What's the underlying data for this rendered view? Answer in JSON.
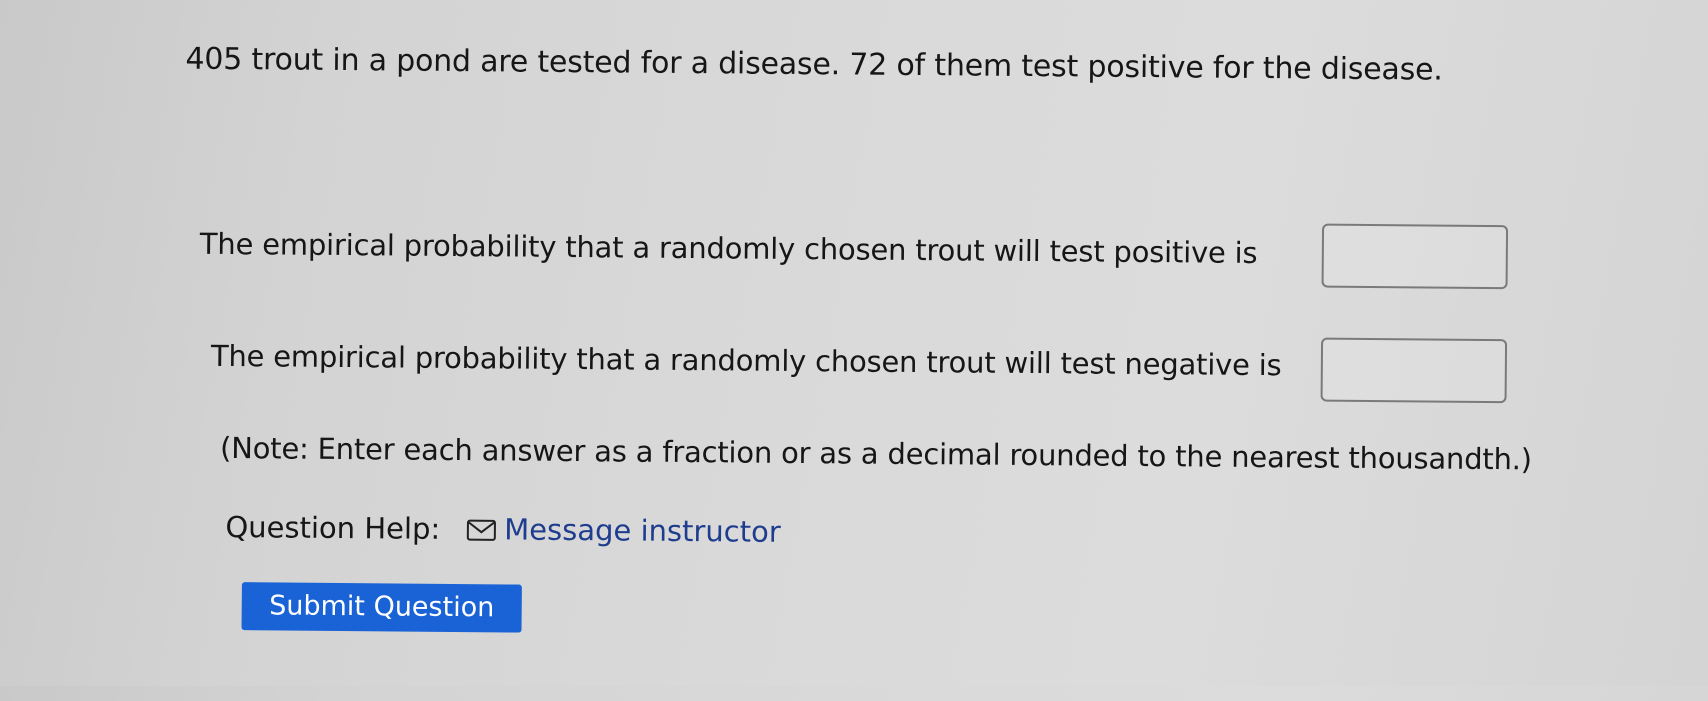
{
  "problem": {
    "text": "405 trout in a pond are tested for a disease. 72 of them test positive for the disease."
  },
  "questions": [
    {
      "text": "The empirical probability that a randomly chosen trout will test positive is",
      "answer_value": "",
      "answer_placeholder": ""
    },
    {
      "text": "The empirical probability that a randomly chosen trout will test negative is",
      "answer_value": "",
      "answer_placeholder": ""
    }
  ],
  "note": "(Note: Enter each answer as a fraction or as a decimal rounded to the nearest thousandth.)",
  "help": {
    "label": "Question Help:",
    "icon": "mail-icon",
    "link_label": "Message instructor"
  },
  "submit": {
    "label": "Submit Question"
  },
  "colors": {
    "link": "#1f3d8f",
    "button": "#1a63d6",
    "button_text": "#ffffff"
  }
}
